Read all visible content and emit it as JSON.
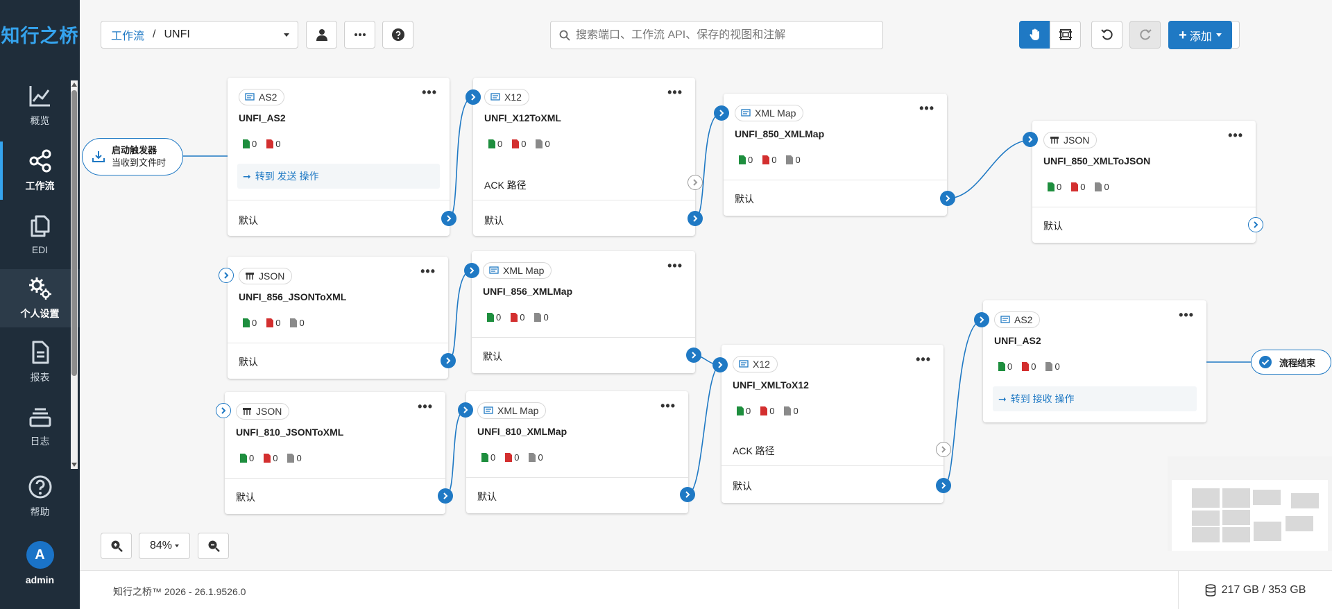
{
  "app": {
    "logo": "知行之桥"
  },
  "sidebar": {
    "items": [
      {
        "label": "概览",
        "icon": "chart-line-icon"
      },
      {
        "label": "工作流",
        "icon": "share-nodes-icon"
      },
      {
        "label": "EDI",
        "icon": "copy-icon"
      },
      {
        "label": "个人设置",
        "icon": "gears-icon"
      },
      {
        "label": "报表",
        "icon": "file-lines-icon"
      },
      {
        "label": "日志",
        "icon": "layers-icon"
      },
      {
        "label": "帮助",
        "icon": "question-circle-icon"
      }
    ],
    "user": {
      "initial": "A",
      "name": "admin"
    }
  },
  "header": {
    "breadcrumb_root": "工作流",
    "breadcrumb_sep": "/",
    "breadcrumb_current": "UNFI",
    "search_placeholder": "搜索端口、工作流 API、保存的视图和注解",
    "add_label": "添加"
  },
  "colors": {
    "accent": "#1f79c4",
    "sidebar": "#1f2d3a",
    "success": "#1e8e3e",
    "error": "#d32f2f",
    "neutral": "#8a8a8a"
  },
  "flow": {
    "trigger": {
      "title": "启动触发器",
      "subtitle": "当收到文件时"
    },
    "end": {
      "label": "流程结束"
    },
    "default_label": "默认",
    "ack_label": "ACK 路径",
    "cards": [
      {
        "type": "AS2",
        "name": "UNFI_AS2",
        "success": "0",
        "error": "0",
        "goto": "转到 发送 操作"
      },
      {
        "type": "X12",
        "name": "UNFI_X12ToXML",
        "success": "0",
        "error": "0",
        "pending": "0"
      },
      {
        "type": "XML Map",
        "name": "UNFI_850_XMLMap",
        "success": "0",
        "error": "0",
        "pending": "0"
      },
      {
        "type": "JSON",
        "name": "UNFI_850_XMLToJSON",
        "success": "0",
        "error": "0",
        "pending": "0"
      },
      {
        "type": "JSON",
        "name": "UNFI_856_JSONToXML",
        "success": "0",
        "error": "0",
        "pending": "0"
      },
      {
        "type": "XML Map",
        "name": "UNFI_856_XMLMap",
        "success": "0",
        "error": "0",
        "pending": "0"
      },
      {
        "type": "JSON",
        "name": "UNFI_810_JSONToXML",
        "success": "0",
        "error": "0",
        "pending": "0"
      },
      {
        "type": "XML Map",
        "name": "UNFI_810_XMLMap",
        "success": "0",
        "error": "0",
        "pending": "0"
      },
      {
        "type": "X12",
        "name": "UNFI_XMLToX12",
        "success": "0",
        "error": "0",
        "pending": "0"
      },
      {
        "type": "AS2",
        "name": "UNFI_AS2",
        "success": "0",
        "error": "0",
        "pending": "0",
        "goto": "转到 接收 操作"
      }
    ]
  },
  "zoom": {
    "level": "84%"
  },
  "footer": {
    "version": "知行之桥™ 2026 - 26.1.9526.0",
    "disk": "217 GB / 353 GB"
  }
}
